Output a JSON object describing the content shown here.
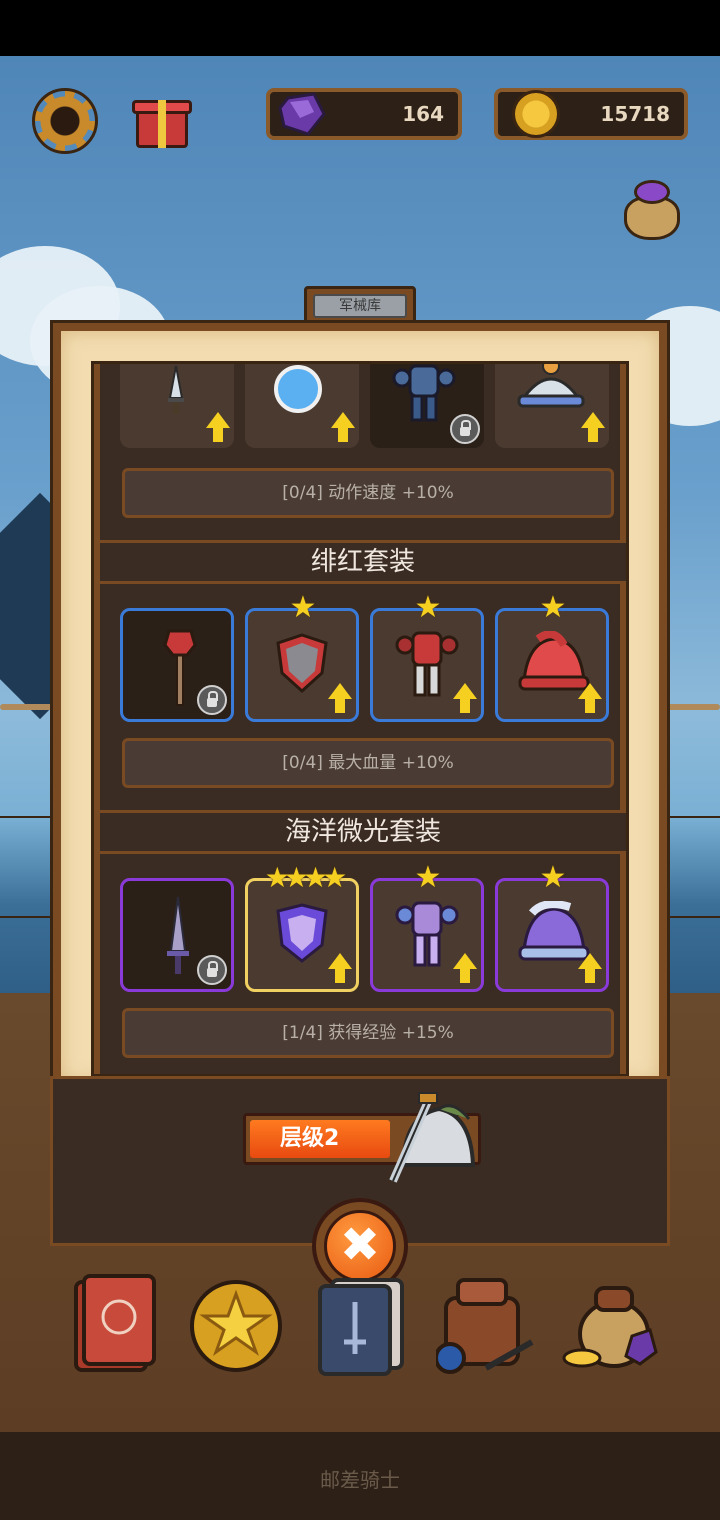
{
  "header": {
    "gems": "164",
    "coins": "15718"
  },
  "panel": {
    "title": "军械库"
  },
  "sets": [
    {
      "name": "",
      "bonus": "[0/4] 动作速度 +10%"
    },
    {
      "name": "绯红套装",
      "bonus": "[0/4] 最大血量 +10%"
    },
    {
      "name": "海洋微光套装",
      "bonus": "[1/4] 获得经验 +15%"
    }
  ],
  "stars": {
    "crimson_shield": "★",
    "crimson_armor": "★",
    "crimson_helmet": "★",
    "ocean_shield": "★★★★",
    "ocean_armor": "★",
    "ocean_helmet": "★"
  },
  "level": {
    "label": "层级2"
  },
  "close_label": "✖",
  "footer": {
    "title": "邮差骑士"
  },
  "icons": [
    "gear-icon",
    "gift-icon",
    "gem-icon",
    "coin-icon",
    "bag-icon",
    "dagger-icon",
    "orb-icon",
    "armor-icon",
    "hat-icon",
    "mace-icon",
    "shield-icon",
    "helmet-icon",
    "sword-icon",
    "lock-icon",
    "upgrade-arrow-icon",
    "book-icon",
    "quest-icon",
    "card-icon",
    "backpack-icon",
    "treasure-icon"
  ],
  "colors": {
    "rare_border": "#3a7ad8",
    "epic_border": "#8a3ad8",
    "star": "#f5d020",
    "upgrade": "#f5d020",
    "button": "#e85a10"
  }
}
